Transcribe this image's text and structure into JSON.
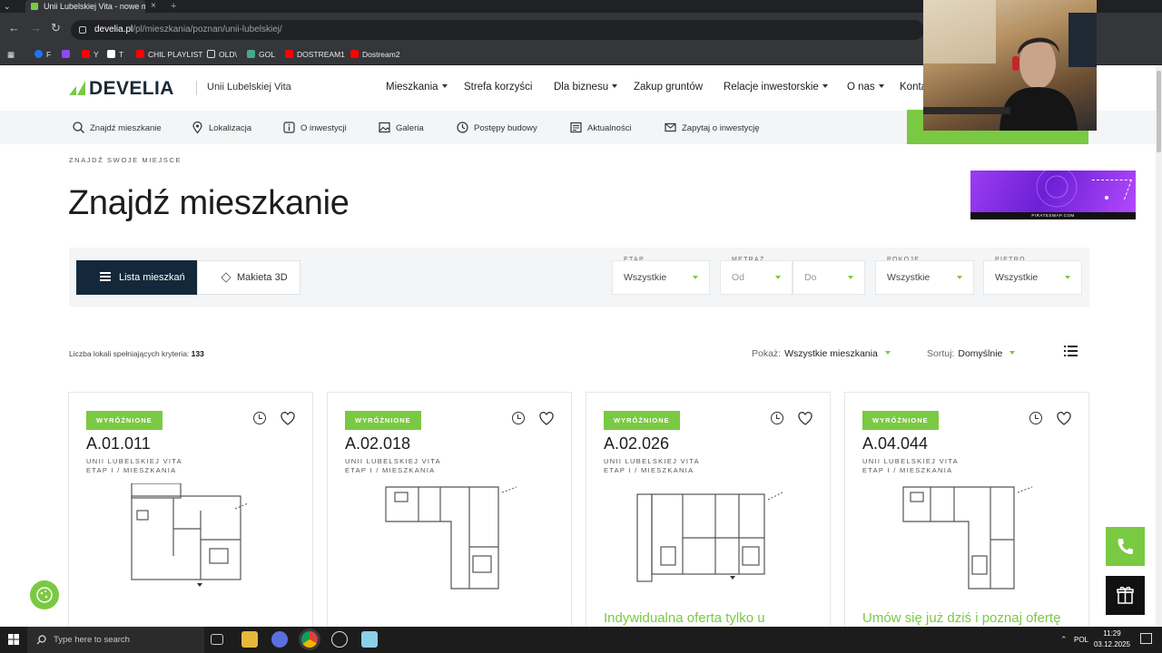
{
  "browser": {
    "tab_title": "Unii Lubelskiej Vita - nowe mie...",
    "address_host": "develia.pl",
    "address_path": "/pl/mieszkania/poznan/unii-lubelskiej/",
    "bookmarks": [
      "F",
      "",
      "Y",
      "T",
      "CHIL PLAYLIST",
      "OLD\\",
      "GOL",
      "DOSTREAM1",
      "Dostream2"
    ]
  },
  "header": {
    "logo": "DEVELIA",
    "investment": "Unii Lubelskiej Vita",
    "nav": [
      "Mieszkania",
      "Strefa korzyści",
      "Dla biznesu",
      "Zakup gruntów",
      "Relacje inwestorskie",
      "O nas",
      "Kontakt"
    ]
  },
  "subnav": [
    "Znajdź mieszkanie",
    "Lokalizacja",
    "O inwestycji",
    "Galeria",
    "Postępy budowy",
    "Aktualności",
    "Zapytaj o inwestycję"
  ],
  "page": {
    "eyebrow": "ZNAJDŹ SWOJE MIEJSCE",
    "title": "Znajdź mieszkanie"
  },
  "ad": {
    "footer": "PIRATESWAP.COM"
  },
  "filters": {
    "view_list": "Lista mieszkań",
    "view_3d": "Makieta 3D",
    "etap_label": "ETAP",
    "etap_value": "Wszystkie",
    "metraz_label": "METRAŻ",
    "metraz_from": "Od",
    "metraz_to": "Do",
    "pokoje_label": "POKOJE",
    "pokoje_value": "Wszystkie",
    "pietro_label": "PIĘTRO",
    "pietro_value": "Wszystkie"
  },
  "results": {
    "count_label": "Liczba lokali spełniających kryteria:",
    "count": "133",
    "show_label": "Pokaż:",
    "show_value": "Wszystkie mieszkania",
    "sort_label": "Sortuj:",
    "sort_value": "Domyślnie"
  },
  "cards": [
    {
      "badge": "WYRÓŻNIONE",
      "code": "A.01.011",
      "loc1": "UNII LUBELSKIEJ VITA",
      "loc2": "ETAP I / MIESZKANIA",
      "promo": ""
    },
    {
      "badge": "WYRÓŻNIONE",
      "code": "A.02.018",
      "loc1": "UNII LUBELSKIEJ VITA",
      "loc2": "ETAP I / MIESZKANIA",
      "promo": ""
    },
    {
      "badge": "WYRÓŻNIONE",
      "code": "A.02.026",
      "loc1": "UNII LUBELSKIEJ VITA",
      "loc2": "ETAP I / MIESZKANIA",
      "promo": "Indywidualna oferta tylko u"
    },
    {
      "badge": "WYRÓŻNIONE",
      "code": "A.04.044",
      "loc1": "UNII LUBELSKIEJ VITA",
      "loc2": "ETAP I / MIESZKANIA",
      "promo": "Umów się już dziś i poznaj ofertę"
    }
  ],
  "taskbar": {
    "search_placeholder": "Type here to search",
    "lang": "POL",
    "time": "11:29",
    "date": "03.12.2025"
  },
  "colors": {
    "accent": "#7ac943",
    "dark": "#13283a"
  }
}
